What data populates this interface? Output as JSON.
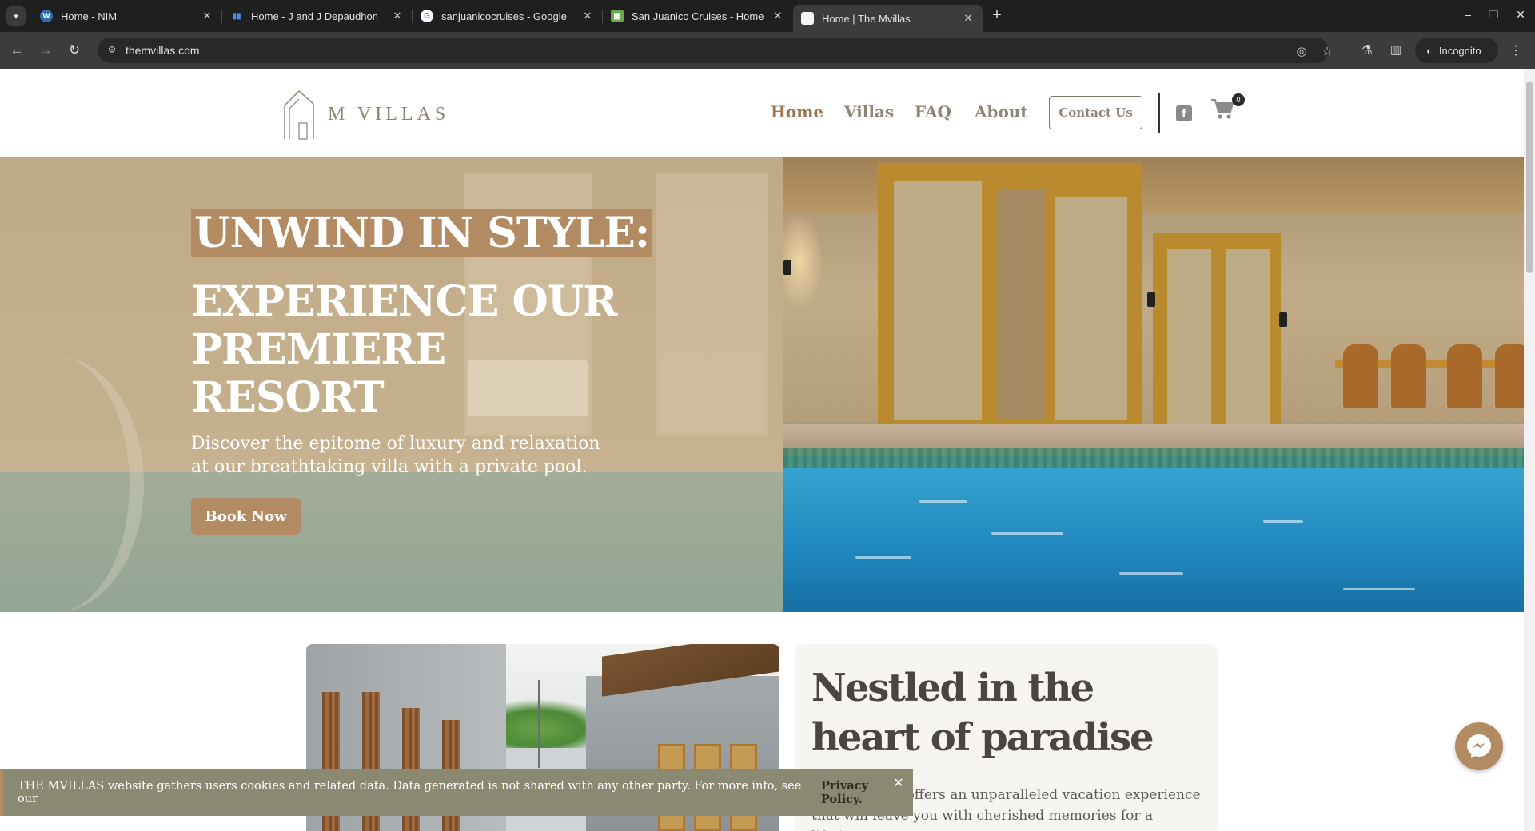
{
  "browser": {
    "tabs": [
      {
        "title": "Home - NIM",
        "favicon": "wordpress-icon"
      },
      {
        "title": "Home - J and J Depaudhon",
        "favicon": "bars-icon"
      },
      {
        "title": "sanjuanicocruises - Google",
        "favicon": "google-icon"
      },
      {
        "title": "San Juanico Cruises - Home",
        "favicon": "sheet-icon"
      },
      {
        "title": "Home | The Mvillas",
        "favicon": "blank-page-icon",
        "active": true
      }
    ],
    "url": "themvillas.com",
    "incognito_label": "Incognito"
  },
  "site": {
    "logo_text": "M VILLAS",
    "nav": [
      {
        "label": "Home",
        "active": true
      },
      {
        "label": "Villas"
      },
      {
        "label": "FAQ"
      },
      {
        "label": "About"
      }
    ],
    "contact_label": "Contact Us",
    "cart_count": "0"
  },
  "hero": {
    "highlight": "UNWIND IN STYLE:",
    "headline": "EXPERIENCE OUR PREMIERE RESORT",
    "subtitle": "Discover the epitome of luxury and relaxation at our breathtaking villa with a private pool.",
    "cta_label": "Book Now"
  },
  "about": {
    "title": "Nestled in the heart of paradise",
    "body": "Our property offers an unparalleled vacation experience that will leave you with cherished memories for a lifetime."
  },
  "cookie": {
    "text": "THE MVILLAS website gathers users cookies and related data. Data generated is not shared with any other party. For more info, see our",
    "policy_link": "Privacy Policy."
  },
  "colors": {
    "accent": "#b38b63",
    "nav_text": "#8c8578",
    "nav_active": "#9a7751",
    "cookie_bg": "#8a8a72",
    "chrome_bg": "#1f1f1f"
  }
}
